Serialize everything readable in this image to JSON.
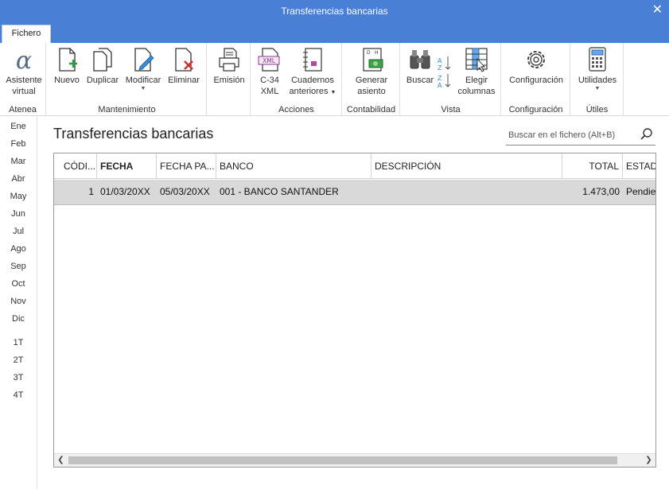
{
  "window": {
    "title": "Transferencias bancarias",
    "close_glyph": "✕"
  },
  "tabs": [
    {
      "label": "Fichero",
      "active": true
    }
  ],
  "ribbon": {
    "groups": [
      {
        "label": "Atenea",
        "buttons": [
          {
            "label_line1": "Asistente",
            "label_line2": "virtual",
            "icon": "alpha-icon"
          }
        ]
      },
      {
        "label": "Mantenimiento",
        "buttons": [
          {
            "label": "Nuevo",
            "icon": "new-document-icon"
          },
          {
            "label": "Duplicar",
            "icon": "duplicate-icon"
          },
          {
            "label": "Modificar",
            "icon": "edit-document-icon",
            "dropdown": true
          },
          {
            "label": "Eliminar",
            "icon": "delete-document-icon"
          }
        ]
      },
      {
        "label": "",
        "buttons": [
          {
            "label": "Emisión",
            "icon": "printer-icon"
          }
        ]
      },
      {
        "label": "Acciones",
        "buttons": [
          {
            "label_line1": "C-34",
            "label_line2": "XML",
            "icon": "xml-file-icon"
          },
          {
            "label_line1": "Cuadernos",
            "label_line2": "anteriores",
            "icon": "notebook-icon",
            "dropdown": true
          }
        ]
      },
      {
        "label": "Contabilidad",
        "buttons": [
          {
            "label_line1": "Generar",
            "label_line2": "asiento",
            "icon": "ledger-entry-icon"
          }
        ]
      },
      {
        "label": "Vista",
        "buttons": [
          {
            "label": "Buscar",
            "icon": "binoculars-icon"
          },
          {
            "label": "",
            "icon": "sort-az-icon"
          },
          {
            "label_line1": "Elegir",
            "label_line2": "columnas",
            "icon": "choose-columns-icon"
          }
        ]
      },
      {
        "label": "Configuración",
        "buttons": [
          {
            "label": "Configuración",
            "icon": "gear-icon"
          }
        ]
      },
      {
        "label": "Útiles",
        "buttons": [
          {
            "label": "Utilidades",
            "icon": "calculator-icon",
            "dropdown": true
          }
        ]
      }
    ],
    "dropdown_glyph": "▼"
  },
  "sidebar": {
    "months": [
      "Ene",
      "Feb",
      "Mar",
      "Abr",
      "May",
      "Jun",
      "Jul",
      "Ago",
      "Sep",
      "Oct",
      "Nov",
      "Dic"
    ],
    "quarters": [
      "1T",
      "2T",
      "3T",
      "4T"
    ]
  },
  "main": {
    "title": "Transferencias bancarias",
    "search_placeholder": "Buscar en el fichero (Alt+B)"
  },
  "table": {
    "columns": [
      "CÓDI...",
      "FECHA",
      "FECHA PA...",
      "BANCO",
      "DESCRIPCIÓN",
      "TOTAL",
      "ESTADO"
    ],
    "rows": [
      {
        "codigo": "1",
        "fecha": "01/03/20XX",
        "fecha_pago": "05/03/20XX",
        "banco": "001 - BANCO SANTANDER",
        "descripcion": "",
        "total": "1.473,00",
        "estado": "Pendiente"
      }
    ]
  },
  "colors": {
    "titlebar": "#4a7fd6",
    "selected_row": "#d9d9d9"
  }
}
